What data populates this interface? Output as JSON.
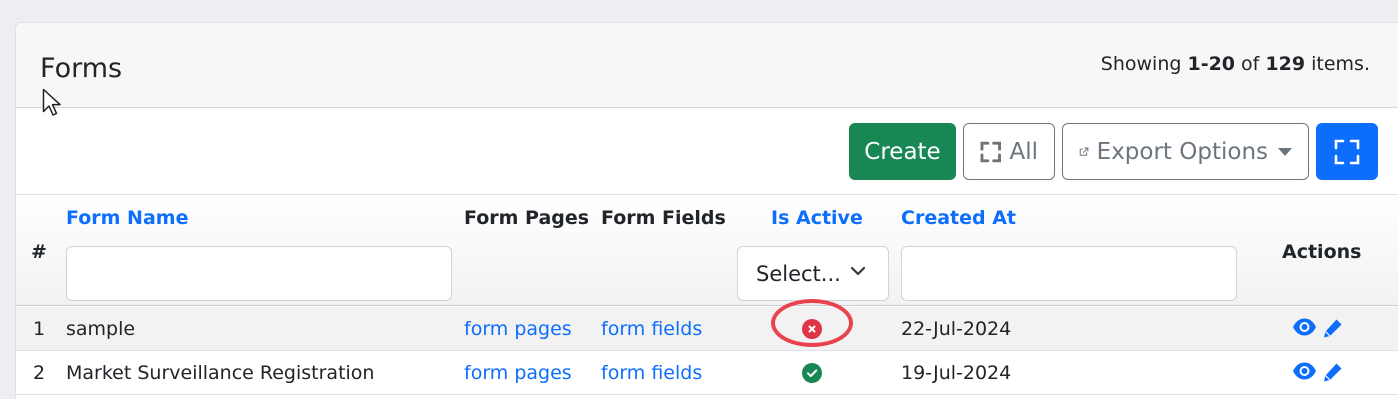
{
  "header": {
    "title": "Forms",
    "summary_prefix": "Showing ",
    "summary_range": "1-20",
    "summary_of": " of ",
    "summary_total": "129",
    "summary_suffix": " items."
  },
  "toolbar": {
    "create_label": "Create",
    "all_label": "All",
    "export_label": "Export Options"
  },
  "table": {
    "columns": {
      "number": "#",
      "form_name": "Form Name",
      "form_pages": "Form Pages",
      "form_fields": "Form Fields",
      "is_active": "Is Active",
      "created_at": "Created At",
      "actions": "Actions"
    },
    "filters": {
      "form_name_value": "",
      "is_active_selected": "Select...",
      "created_at_value": ""
    },
    "rows": [
      {
        "num": "1",
        "name": "sample",
        "pages": "form pages",
        "fields": "form fields",
        "active": false,
        "created": "22-Jul-2024"
      },
      {
        "num": "2",
        "name": "Market Surveillance Registration",
        "pages": "form pages",
        "fields": "form fields",
        "active": true,
        "created": "19-Jul-2024"
      }
    ]
  },
  "colors": {
    "primary": "#0d6efd",
    "success": "#198754",
    "danger": "#dc3545",
    "annotation": "#e8434e"
  },
  "icons": {
    "all": "expand-corners-icon",
    "export": "external-link-icon",
    "fullscreen": "fullscreen-icon",
    "view": "eye-icon",
    "edit": "pencil-icon",
    "inactive": "x-circle-icon",
    "active": "check-circle-icon"
  }
}
